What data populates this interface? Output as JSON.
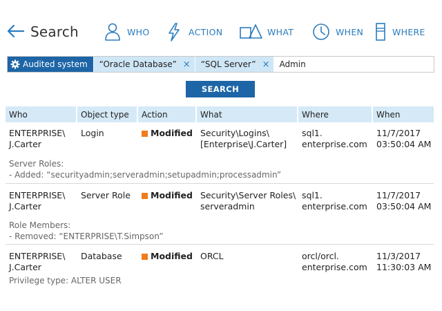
{
  "header": {
    "title": "Search",
    "nav": [
      {
        "label": "WHO",
        "icon": "person-icon"
      },
      {
        "label": "ACTION",
        "icon": "lightning-icon"
      },
      {
        "label": "WHAT",
        "icon": "object-shapes-icon"
      },
      {
        "label": "WHEN",
        "icon": "clock-icon"
      },
      {
        "label": "WHERE",
        "icon": "server-icon"
      }
    ]
  },
  "search": {
    "audited_chip": "Audited system",
    "filters": [
      "“Oracle Database”",
      "“SQL Server”"
    ],
    "remove_glyph": "×",
    "input_value": "Admin",
    "button_label": "SEARCH"
  },
  "table": {
    "columns": [
      "Who",
      "Object type",
      "Action",
      "What",
      "Where",
      "When"
    ],
    "rows": [
      {
        "who": [
          "ENTERPRISE\\",
          "J.Carter"
        ],
        "object_type": "Login",
        "action": "Modified",
        "what": [
          "Security\\Logins\\",
          "[Enterprise\\J.Carter]"
        ],
        "where": [
          "sql1.",
          "enterprise.com"
        ],
        "when": [
          "11/7/2017",
          "03:50:04 AM"
        ],
        "details": [
          "Server Roles:",
          "- Added: “securityadmin;serveradmin;setupadmin;processadmin”"
        ]
      },
      {
        "who": [
          "ENTERPRISE\\",
          "J.Carter"
        ],
        "object_type": "Server Role",
        "action": "Modified",
        "what": [
          "Security\\Server Roles\\",
          "serveradmin"
        ],
        "where": [
          "sql1.",
          "enterprise.com"
        ],
        "when": [
          "11/7/2017",
          "03:50:04 AM"
        ],
        "details": [
          "Role Members:",
          "- Removed: “ENTERPRISE\\T.Simpson”"
        ]
      },
      {
        "who": [
          "ENTERPRISE\\",
          "J.Carter"
        ],
        "object_type": "Database",
        "action": "Modified",
        "what": [
          "ORCL",
          ""
        ],
        "where": [
          "orcl/orcl.",
          "enterprise.com"
        ],
        "when": [
          "11/3/2017",
          "11:30:03 AM"
        ],
        "details": [
          "Privilege type: ALTER USER"
        ]
      }
    ]
  },
  "colors": {
    "accent": "#1d65a6",
    "link": "#2a7bbd",
    "chip": "#cfe6f6",
    "header_row": "#d5e9f7",
    "modified": "#f07c1b"
  }
}
